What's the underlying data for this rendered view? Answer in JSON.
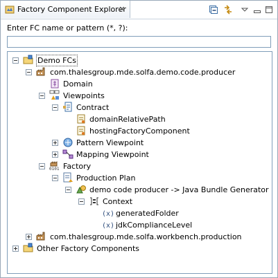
{
  "view": {
    "title": "Factory Component Explorer",
    "close_glyph": "×",
    "toolbar": [
      {
        "icon": "collapse-all-icon"
      },
      {
        "icon": "link-with-editor-icon"
      },
      {
        "icon": "view-menu-icon"
      },
      {
        "icon": "minimize-icon"
      },
      {
        "icon": "maximize-icon"
      }
    ]
  },
  "filter": {
    "label": "Enter FC name or pattern (*, ?):",
    "value": "",
    "placeholder": ""
  },
  "tree": {
    "items": [
      {
        "label": "Demo FCs",
        "icon": "folder-fc-icon",
        "expander": "minus"
      },
      {
        "label": "com.thalesgroup.mde.solfa.demo.code.producer",
        "icon": "factory-component-icon",
        "expander": "minus"
      },
      {
        "label": "Domain",
        "icon": "domain-icon",
        "expander": "none"
      },
      {
        "label": "Viewpoints",
        "icon": "viewpoints-icon",
        "expander": "minus"
      },
      {
        "label": "Contract",
        "icon": "contract-icon",
        "expander": "minus"
      },
      {
        "label": "domainRelativePath",
        "icon": "contract-element-icon",
        "expander": "none"
      },
      {
        "label": "hostingFactoryComponent",
        "icon": "contract-element-icon",
        "expander": "none"
      },
      {
        "label": "Pattern Viewpoint",
        "icon": "pattern-viewpoint-icon",
        "expander": "plus"
      },
      {
        "label": "Mapping Viewpoint",
        "icon": "mapping-viewpoint-icon",
        "expander": "plus"
      },
      {
        "label": "Factory",
        "icon": "factory-icon",
        "expander": "minus"
      },
      {
        "label": "Production Plan",
        "icon": "production-plan-icon",
        "expander": "minus"
      },
      {
        "label": "demo code producer -> Java Bundle Generator",
        "icon": "generator-icon",
        "expander": "minus"
      },
      {
        "label": "Context",
        "icon": "context-icon",
        "expander": "minus"
      },
      {
        "label": "generatedFolder",
        "icon": "variable-icon",
        "expander": "none"
      },
      {
        "label": "jdkComplianceLevel",
        "icon": "variable-icon",
        "expander": "none"
      },
      {
        "label": "com.thalesgroup.mde.solfa.workbench.production",
        "icon": "factory-component-icon",
        "expander": "plus"
      },
      {
        "label": "Other Factory Components",
        "icon": "folder-fc-icon",
        "expander": "plus"
      }
    ]
  }
}
